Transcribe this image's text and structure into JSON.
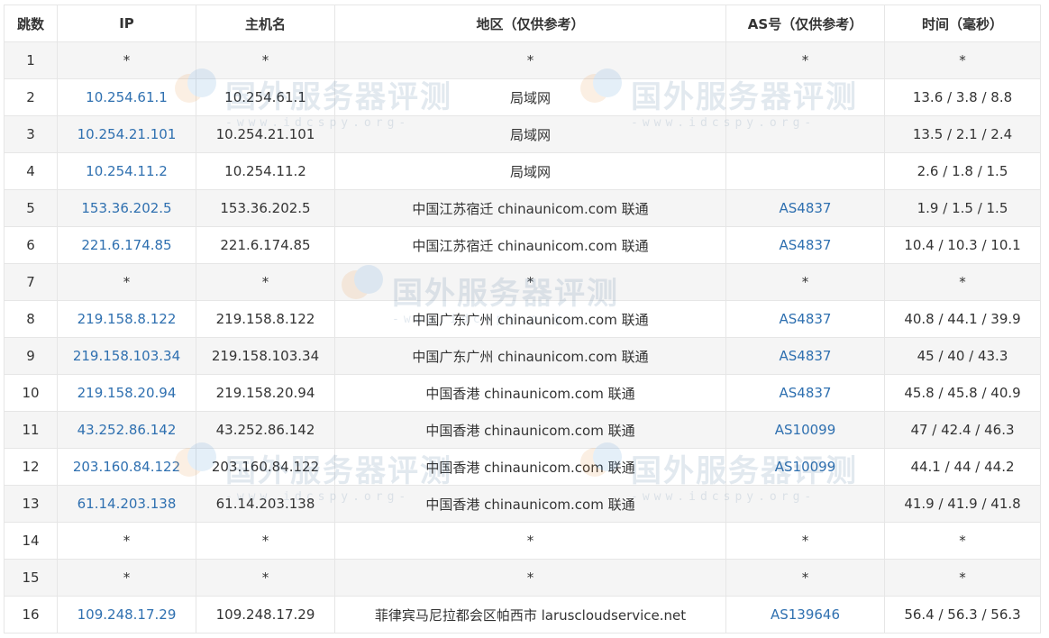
{
  "table": {
    "headers": [
      "跳数",
      "IP",
      "主机名",
      "地区（仅供参考）",
      "AS号（仅供参考）",
      "时间（毫秒）"
    ],
    "rows": [
      {
        "hop": "1",
        "ip": "*",
        "host": "*",
        "region": "*",
        "asn": "*",
        "time": "*"
      },
      {
        "hop": "2",
        "ip": "10.254.61.1",
        "host": "10.254.61.1",
        "region": "局域网",
        "asn": "",
        "time": "13.6 / 3.8 / 8.8"
      },
      {
        "hop": "3",
        "ip": "10.254.21.101",
        "host": "10.254.21.101",
        "region": "局域网",
        "asn": "",
        "time": "13.5 / 2.1 / 2.4"
      },
      {
        "hop": "4",
        "ip": "10.254.11.2",
        "host": "10.254.11.2",
        "region": "局域网",
        "asn": "",
        "time": "2.6 / 1.8 / 1.5"
      },
      {
        "hop": "5",
        "ip": "153.36.202.5",
        "host": "153.36.202.5",
        "region": "中国江苏宿迁 chinaunicom.com 联通",
        "asn": "AS4837",
        "time": "1.9 / 1.5 / 1.5"
      },
      {
        "hop": "6",
        "ip": "221.6.174.85",
        "host": "221.6.174.85",
        "region": "中国江苏宿迁 chinaunicom.com 联通",
        "asn": "AS4837",
        "time": "10.4 / 10.3 / 10.1"
      },
      {
        "hop": "7",
        "ip": "*",
        "host": "*",
        "region": "*",
        "asn": "*",
        "time": "*"
      },
      {
        "hop": "8",
        "ip": "219.158.8.122",
        "host": "219.158.8.122",
        "region": "中国广东广州 chinaunicom.com 联通",
        "asn": "AS4837",
        "time": "40.8 / 44.1 / 39.9"
      },
      {
        "hop": "9",
        "ip": "219.158.103.34",
        "host": "219.158.103.34",
        "region": "中国广东广州 chinaunicom.com 联通",
        "asn": "AS4837",
        "time": "45 / 40 / 43.3"
      },
      {
        "hop": "10",
        "ip": "219.158.20.94",
        "host": "219.158.20.94",
        "region": "中国香港 chinaunicom.com 联通",
        "asn": "AS4837",
        "time": "45.8 / 45.8 / 40.9"
      },
      {
        "hop": "11",
        "ip": "43.252.86.142",
        "host": "43.252.86.142",
        "region": "中国香港 chinaunicom.com 联通",
        "asn": "AS10099",
        "time": "47 / 42.4 / 46.3"
      },
      {
        "hop": "12",
        "ip": "203.160.84.122",
        "host": "203.160.84.122",
        "region": "中国香港 chinaunicom.com 联通",
        "asn": "AS10099",
        "time": "44.1 / 44 / 44.2"
      },
      {
        "hop": "13",
        "ip": "61.14.203.138",
        "host": "61.14.203.138",
        "region": "中国香港 chinaunicom.com 联通",
        "asn": "",
        "time": "41.9 / 41.9 / 41.8"
      },
      {
        "hop": "14",
        "ip": "*",
        "host": "*",
        "region": "*",
        "asn": "*",
        "time": "*"
      },
      {
        "hop": "15",
        "ip": "*",
        "host": "*",
        "region": "*",
        "asn": "*",
        "time": "*"
      },
      {
        "hop": "16",
        "ip": "109.248.17.29",
        "host": "109.248.17.29",
        "region": "菲律宾马尼拉都会区帕西市 laruscloudservice.net",
        "asn": "AS139646",
        "time": "56.4 / 56.3 / 56.3"
      }
    ]
  },
  "watermark": {
    "title": "国外服务器评测",
    "url": "-www.idcspy.org-"
  },
  "colors": {
    "link": "#2f70b0",
    "text": "#333333",
    "border": "#e6e6e6",
    "stripe": "#f5f5f5"
  }
}
